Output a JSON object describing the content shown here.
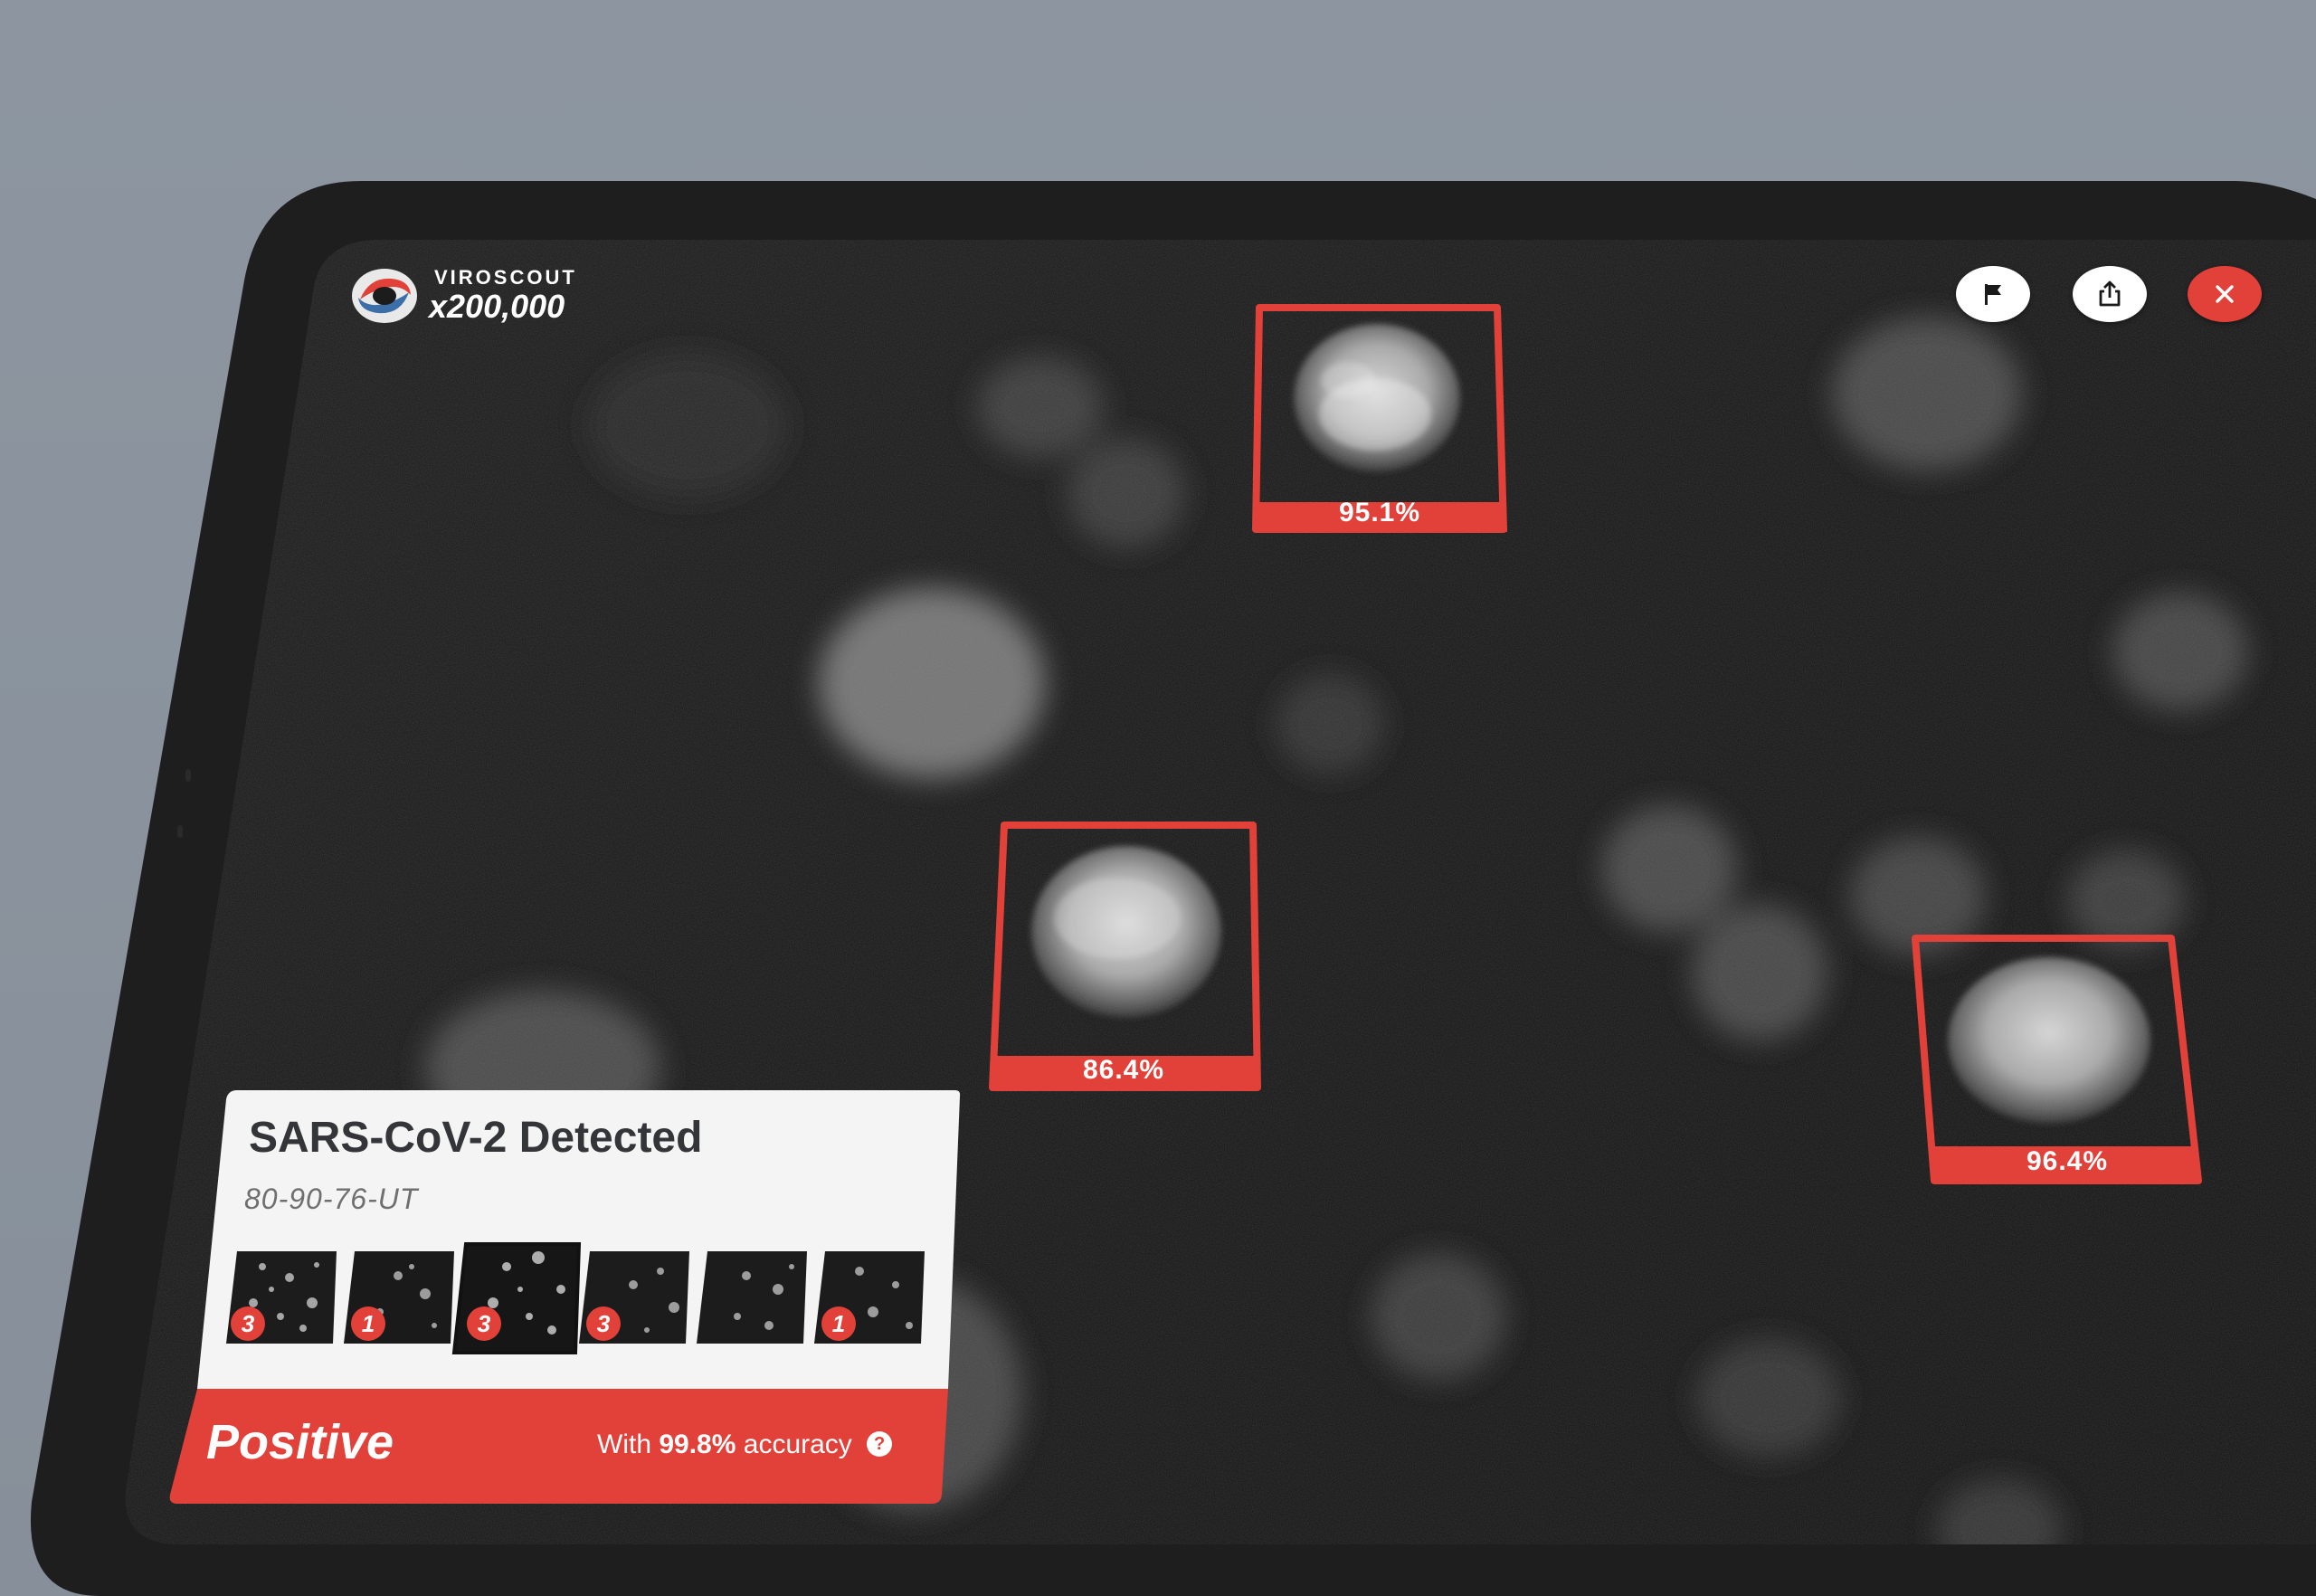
{
  "app": {
    "brand": "VIROSCOUT",
    "zoom_level": "x200,000"
  },
  "toolbar": {
    "flag_icon": "flag-icon",
    "share_icon": "share-icon",
    "close_icon": "close-icon"
  },
  "detections": [
    {
      "confidence": "95.1%"
    },
    {
      "confidence": "86.4%"
    },
    {
      "confidence": "96.4%"
    }
  ],
  "result": {
    "title": "SARS-CoV-2 Detected",
    "sample_id": "80-90-76-UT",
    "status": "Positive",
    "accuracy_prefix": "With",
    "accuracy_value": "99.8%",
    "accuracy_suffix": "accuracy",
    "thumbnails": [
      {
        "count": "3"
      },
      {
        "count": "1"
      },
      {
        "count": "3"
      },
      {
        "count": "3"
      },
      {
        "count": ""
      },
      {
        "count": "1"
      }
    ]
  },
  "colors": {
    "accent": "#e2413a",
    "background": "#8a939c",
    "bezel": "#1e1e1f",
    "screen": "#121212",
    "card": "#f4f4f4"
  }
}
